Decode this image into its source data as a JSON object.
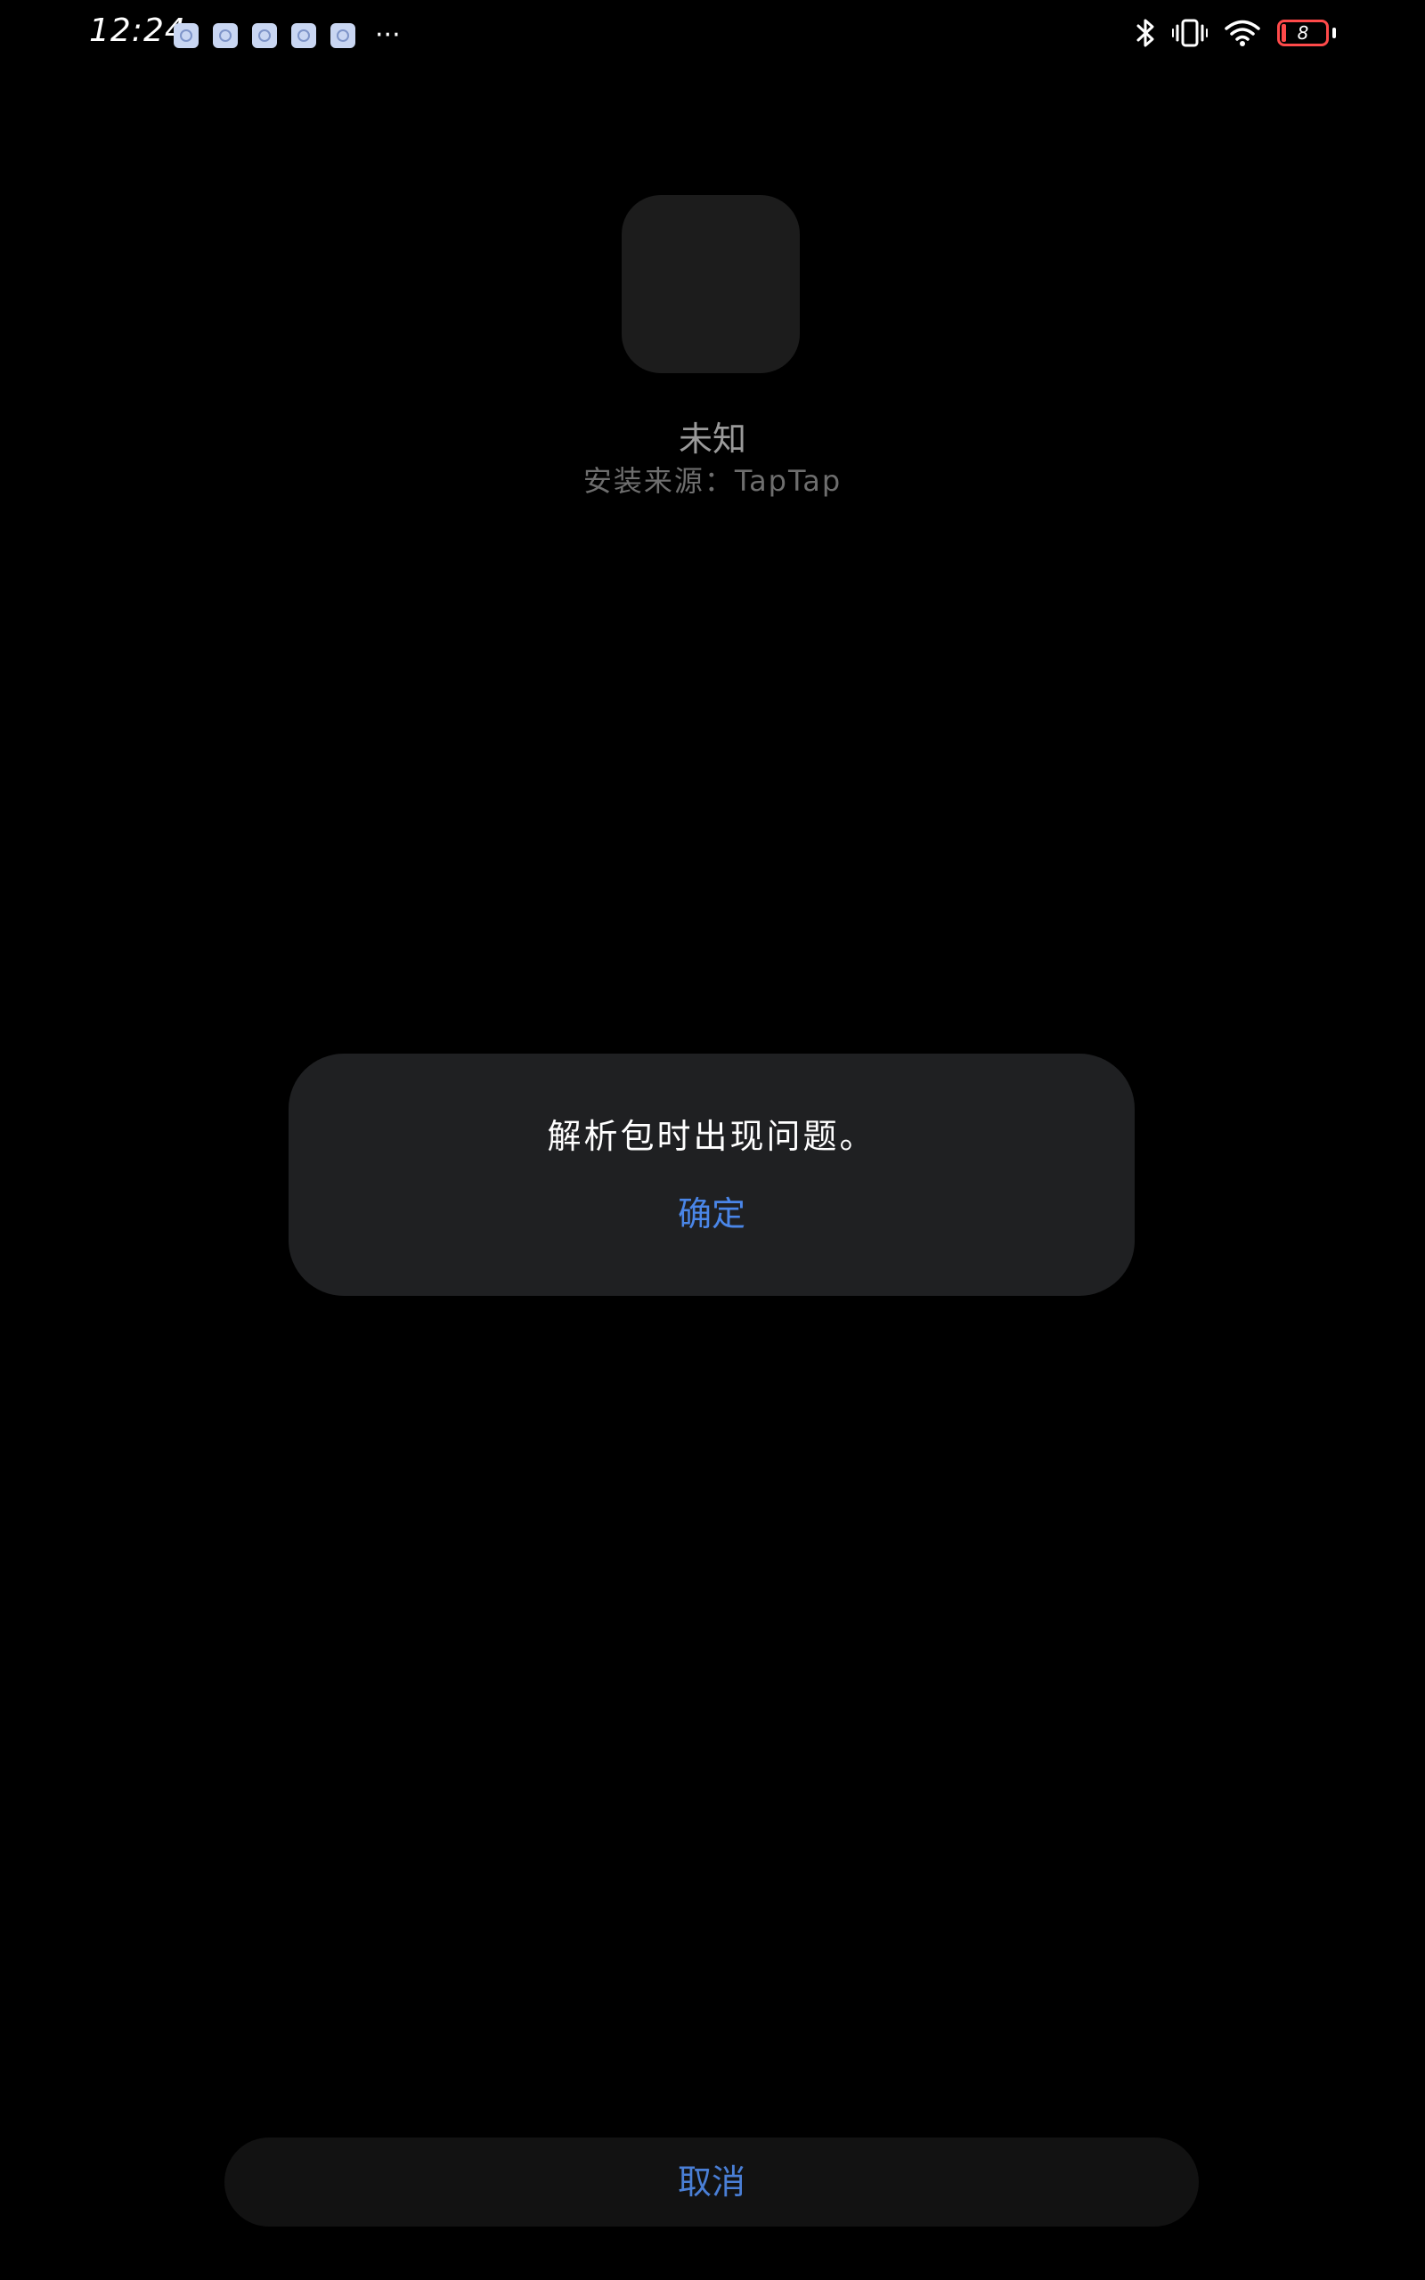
{
  "status_bar": {
    "time": "12:24",
    "more_indicator": "···",
    "battery_level": "8",
    "icons": [
      "bluetooth-icon",
      "vibrate-icon",
      "wifi-icon",
      "battery-icon"
    ]
  },
  "app": {
    "name": "未知",
    "source": "安装来源：TapTap"
  },
  "dialog": {
    "message": "解析包时出现问题。",
    "confirm_label": "确定"
  },
  "footer": {
    "cancel_label": "取消"
  },
  "colors": {
    "background": "#000000",
    "dialog_bg": "#1f2022",
    "accent": "#4a86e8",
    "battery_low": "#ff4a4a"
  }
}
